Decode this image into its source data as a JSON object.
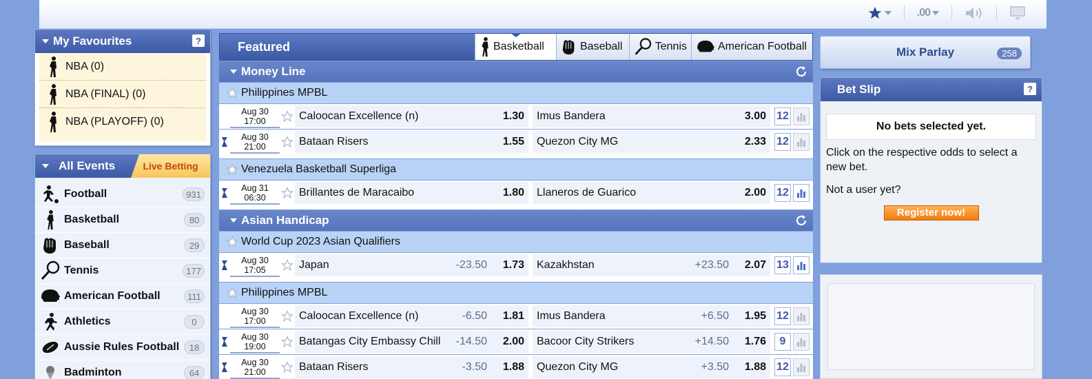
{
  "topbar": {
    "odds_format": ".00"
  },
  "favourites": {
    "title": "My Favourites",
    "help": "?",
    "items": [
      {
        "label": "NBA (0)"
      },
      {
        "label": "NBA (FINAL) (0)"
      },
      {
        "label": "NBA (PLAYOFF) (0)"
      }
    ]
  },
  "all_events": {
    "title": "All Events",
    "live_tab": "Live Betting",
    "sports": [
      {
        "name": "Football",
        "count": "931",
        "icon": "football-player-icon"
      },
      {
        "name": "Basketball",
        "count": "80",
        "icon": "basketball-player-icon"
      },
      {
        "name": "Baseball",
        "count": "29",
        "icon": "baseball-glove-icon"
      },
      {
        "name": "Tennis",
        "count": "177",
        "icon": "tennis-racket-icon"
      },
      {
        "name": "American Football",
        "count": "111",
        "icon": "football-helmet-icon"
      },
      {
        "name": "Athletics",
        "count": "0",
        "icon": "runner-icon"
      },
      {
        "name": "Aussie Rules Football",
        "count": "18",
        "icon": "aussie-ball-icon"
      },
      {
        "name": "Badminton",
        "count": "64",
        "icon": "shuttlecock-icon"
      }
    ]
  },
  "featured": {
    "title": "Featured",
    "tabs": [
      {
        "label": "Basketball",
        "active": true
      },
      {
        "label": "Baseball"
      },
      {
        "label": "Tennis"
      },
      {
        "label": "American Football"
      }
    ]
  },
  "money_line": {
    "title": "Money Line",
    "leagues": [
      {
        "name": "Philippines MPBL",
        "matches": [
          {
            "date": "Aug 30",
            "time": "17:00",
            "home": "Caloocan Excellence (n)",
            "home_odd": "1.30",
            "away": "Imus Bandera",
            "away_odd": "3.00",
            "more": "12"
          },
          {
            "date": "Aug 30",
            "time": "21:00",
            "home": "Bataan Risers",
            "home_odd": "1.55",
            "away": "Quezon City MG",
            "away_odd": "2.33",
            "more": "12"
          }
        ]
      },
      {
        "name": "Venezuela Basketball Superliga",
        "matches": [
          {
            "date": "Aug 31",
            "time": "06:30",
            "home": "Brillantes de Maracaibo",
            "home_odd": "1.80",
            "away": "Llaneros de Guarico",
            "away_odd": "2.00",
            "more": "12"
          }
        ]
      }
    ]
  },
  "asian_handicap": {
    "title": "Asian Handicap",
    "leagues": [
      {
        "name": "World Cup 2023 Asian Qualifiers",
        "matches": [
          {
            "date": "Aug 30",
            "time": "17:05",
            "home": "Japan",
            "home_hdp": "-23.50",
            "home_odd": "1.73",
            "away": "Kazakhstan",
            "away_hdp": "+23.50",
            "away_odd": "2.07",
            "more": "13"
          }
        ]
      },
      {
        "name": "Philippines MPBL",
        "matches": [
          {
            "date": "Aug 30",
            "time": "17:00",
            "home": "Caloocan Excellence (n)",
            "home_hdp": "-6.50",
            "home_odd": "1.81",
            "away": "Imus Bandera",
            "away_hdp": "+6.50",
            "away_odd": "1.95",
            "more": "12"
          },
          {
            "date": "Aug 30",
            "time": "19:00",
            "home": "Batangas City Embassy Chill",
            "home_hdp": "-14.50",
            "home_odd": "2.00",
            "away": "Bacoor City Strikers",
            "away_hdp": "+14.50",
            "away_odd": "1.76",
            "more": "9"
          },
          {
            "date": "Aug 30",
            "time": "21:00",
            "home": "Bataan Risers",
            "home_hdp": "-3.50",
            "home_odd": "1.88",
            "away": "Quezon City MG",
            "away_hdp": "+3.50",
            "away_odd": "1.88",
            "more": "12"
          }
        ]
      }
    ]
  },
  "mix_parlay": {
    "label": "Mix Parlay",
    "count": "258"
  },
  "bet_slip": {
    "title": "Bet Slip",
    "help": "?",
    "empty": "No bets selected yet.",
    "instructions": "Click on the respective odds to select a new bet.",
    "not_user": "Not a user yet?",
    "register": "Register now!"
  }
}
